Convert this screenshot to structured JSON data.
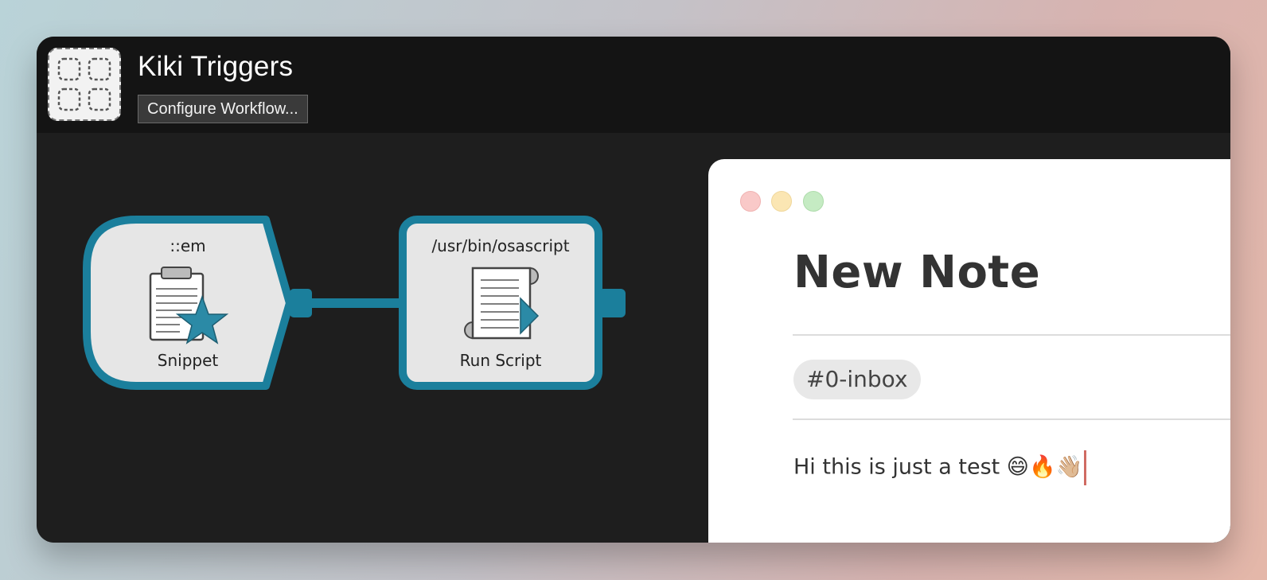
{
  "app": {
    "title": "Kiki Triggers",
    "configure_button_label": "Configure Workflow..."
  },
  "workflow": {
    "nodes": [
      {
        "keyword": "::em",
        "label": "Snippet",
        "icon": "clipboard-star-icon"
      },
      {
        "keyword": "/usr/bin/osascript",
        "label": "Run Script",
        "icon": "script-icon"
      }
    ],
    "accent_color": "#1b7f9c"
  },
  "note_window": {
    "title": "New Note",
    "tag": "#0-inbox",
    "body": "Hi this is just a test 😄🔥👋🏼"
  }
}
